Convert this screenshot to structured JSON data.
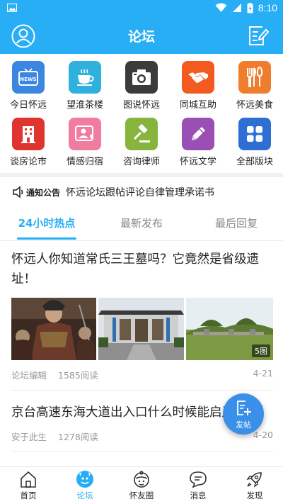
{
  "status_bar": {
    "time": "8:10"
  },
  "header": {
    "title": "论坛"
  },
  "grid": [
    {
      "label": "今日怀远",
      "icon": "news-tv-icon",
      "color": "#3a86e0"
    },
    {
      "label": "望淮茶楼",
      "icon": "tea-cup-icon",
      "color": "#2fb1dd"
    },
    {
      "label": "图说怀远",
      "icon": "camera-icon",
      "color": "#3b3b3b"
    },
    {
      "label": "同城互助",
      "icon": "handshake-icon",
      "color": "#f25a1f"
    },
    {
      "label": "怀远美食",
      "icon": "utensils-icon",
      "color": "#f07d2d"
    },
    {
      "label": "谈房论市",
      "icon": "building-icon",
      "color": "#e0342e"
    },
    {
      "label": "情感归宿",
      "icon": "heart-person-icon",
      "color": "#f07ca0"
    },
    {
      "label": "咨询律师",
      "icon": "gavel-icon",
      "color": "#86b43c"
    },
    {
      "label": "怀远文学",
      "icon": "pencil-icon",
      "color": "#9a4fb5"
    },
    {
      "label": "全部版块",
      "icon": "all-blocks-icon",
      "color": "#2d6fd4"
    }
  ],
  "notice": {
    "tag": "通知公告",
    "text": "怀远论坛跟帖评论自律管理承诺书"
  },
  "tabs": [
    {
      "label": "24小时热点",
      "active": true
    },
    {
      "label": "最新发布",
      "active": false
    },
    {
      "label": "最后回复",
      "active": false
    }
  ],
  "posts": [
    {
      "title": "怀远人你知道常氏三王墓吗？它竟然是省级遗址！",
      "author": "论坛编辑",
      "views": "1585阅读",
      "date": "4-21",
      "image_count": "5图"
    },
    {
      "title": "京台高速东海大道出入口什么时候能启用",
      "author": "安于此生",
      "views": "1278阅读",
      "date": "4-20"
    }
  ],
  "fab": {
    "label": "发帖"
  },
  "bottom_nav": [
    {
      "label": "首页",
      "icon": "home-icon",
      "active": false
    },
    {
      "label": "论坛",
      "icon": "forum-icon",
      "active": true
    },
    {
      "label": "怀友圈",
      "icon": "friends-circle-icon",
      "active": false
    },
    {
      "label": "消息",
      "icon": "message-icon",
      "active": false
    },
    {
      "label": "发现",
      "icon": "discover-rocket-icon",
      "active": false
    }
  ],
  "colors": {
    "primary": "#27aef4",
    "fab": "#3a8fe8"
  }
}
